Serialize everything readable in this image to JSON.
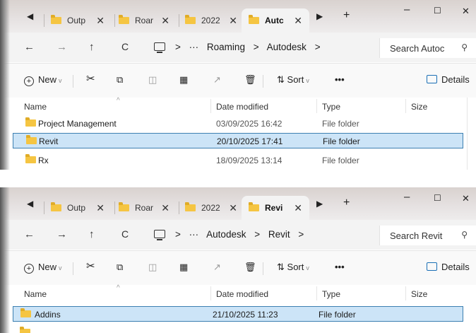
{
  "windows": [
    {
      "tabs": [
        {
          "label": "Outp",
          "close": "✕"
        },
        {
          "label": "Roar",
          "close": "✕"
        },
        {
          "label": "2022",
          "close": "✕"
        },
        {
          "label": "Autc",
          "close": "✕"
        }
      ],
      "new_tab": "+",
      "breadcrumbs": [
        "Roaming",
        "Autodesk"
      ],
      "search_placeholder": "Search Autoc",
      "toolbar": {
        "new": "New",
        "sort": "Sort",
        "more": "•••",
        "details": "Details"
      },
      "columns": {
        "name": "Name",
        "date": "Date modified",
        "type": "Type",
        "size": "Size"
      },
      "rows": [
        {
          "name": "Project Management",
          "date": "03/09/2025 16:42",
          "type": "File folder",
          "selected": false
        },
        {
          "name": "Revit",
          "date": "20/10/2025 17:41",
          "type": "File folder",
          "selected": true
        },
        {
          "name": "Rx",
          "date": "18/09/2025 13:14",
          "type": "File folder",
          "selected": false
        }
      ]
    },
    {
      "tabs": [
        {
          "label": "Outp",
          "close": "✕"
        },
        {
          "label": "Roar",
          "close": "✕"
        },
        {
          "label": "2022",
          "close": "✕"
        },
        {
          "label": "Revi",
          "close": "✕"
        }
      ],
      "new_tab": "+",
      "breadcrumbs": [
        "Autodesk",
        "Revit"
      ],
      "search_placeholder": "Search Revit",
      "toolbar": {
        "new": "New",
        "sort": "Sort",
        "more": "•••",
        "details": "Details"
      },
      "columns": {
        "name": "Name",
        "date": "Date modified",
        "type": "Type",
        "size": "Size"
      },
      "rows": [
        {
          "name": "Addins",
          "date": "21/10/2025 11:23",
          "type": "File folder",
          "selected": true
        }
      ]
    }
  ],
  "icons": {
    "back": "←",
    "forward": "→",
    "up": "↑",
    "refresh": "C",
    "ellipsis": "···",
    "chevron": ">",
    "search": "🔍",
    "minimize": "–",
    "maximize": "☐",
    "close": "✕",
    "tab_back": "◀",
    "tab_forward": "▶"
  },
  "colors": {
    "selection": "#cce4f7",
    "selection_border": "#3c7fb1",
    "folder": "#f5c542"
  }
}
